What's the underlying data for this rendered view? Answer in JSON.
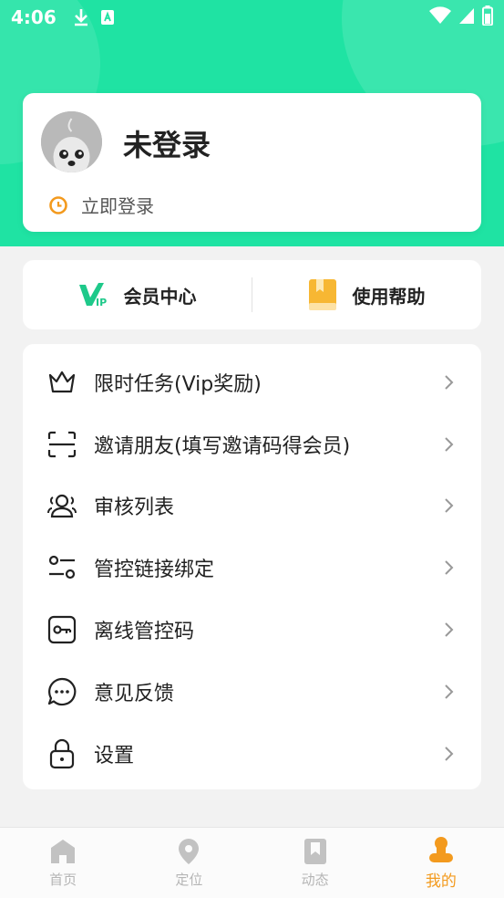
{
  "status_bar": {
    "time": "4:06"
  },
  "profile": {
    "title": "未登录",
    "login_label": "立即登录"
  },
  "quick_links": [
    {
      "label": "会员中心",
      "icon": "vip-icon"
    },
    {
      "label": "使用帮助",
      "icon": "book-icon"
    }
  ],
  "menu": [
    {
      "label": "限时任务(Vip奖励)",
      "icon": "crown-icon"
    },
    {
      "label": "邀请朋友(填写邀请码得会员)",
      "icon": "scan-icon"
    },
    {
      "label": "审核列表",
      "icon": "users-icon"
    },
    {
      "label": "管控链接绑定",
      "icon": "toggle-settings-icon"
    },
    {
      "label": "离线管控码",
      "icon": "key-icon"
    },
    {
      "label": "意见反馈",
      "icon": "chat-icon"
    },
    {
      "label": "设置",
      "icon": "lock-icon"
    }
  ],
  "bottom_nav": [
    {
      "label": "首页",
      "icon": "home-icon",
      "active": false
    },
    {
      "label": "定位",
      "icon": "location-icon",
      "active": false
    },
    {
      "label": "动态",
      "icon": "bookmark-icon",
      "active": false
    },
    {
      "label": "我的",
      "icon": "person-icon",
      "active": true
    }
  ],
  "colors": {
    "accent_green": "#1fe3a3",
    "active_orange": "#f39a1e",
    "vip_green": "#1ec98a"
  }
}
